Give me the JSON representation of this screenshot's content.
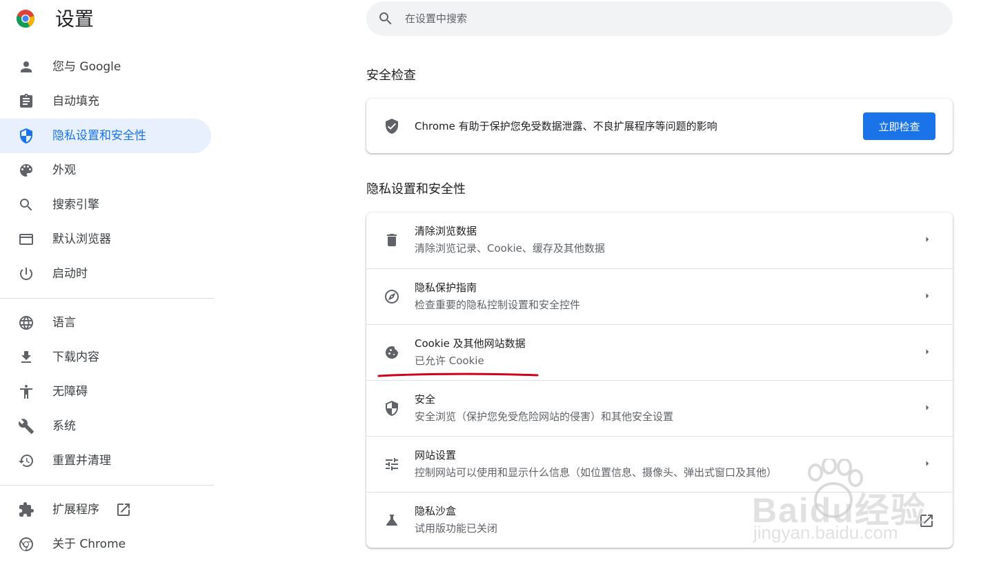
{
  "app": {
    "title": "设置"
  },
  "sidebar": {
    "items": [
      {
        "label": "您与 Google",
        "icon": "person-icon"
      },
      {
        "label": "自动填充",
        "icon": "clipboard-icon"
      },
      {
        "label": "隐私设置和安全性",
        "icon": "shield-icon",
        "active": true
      },
      {
        "label": "外观",
        "icon": "palette-icon"
      },
      {
        "label": "搜索引擎",
        "icon": "search-icon"
      },
      {
        "label": "默认浏览器",
        "icon": "browser-window-icon"
      },
      {
        "label": "启动时",
        "icon": "power-icon"
      }
    ],
    "advanced_items": [
      {
        "label": "语言",
        "icon": "globe-icon"
      },
      {
        "label": "下载内容",
        "icon": "download-icon"
      },
      {
        "label": "无障碍",
        "icon": "accessibility-icon"
      },
      {
        "label": "系统",
        "icon": "wrench-icon"
      },
      {
        "label": "重置并清理",
        "icon": "restore-icon"
      }
    ],
    "bottom_items": [
      {
        "label": "扩展程序",
        "icon": "puzzle-icon"
      },
      {
        "label": "关于 Chrome",
        "icon": "chrome-icon"
      }
    ]
  },
  "search": {
    "placeholder": "在设置中搜索"
  },
  "safety_check": {
    "section_title": "安全检查",
    "text": "Chrome 有助于保护您免受数据泄露、不良扩展程序等问题的影响",
    "button_label": "立即检查"
  },
  "privacy": {
    "section_title": "隐私设置和安全性",
    "rows": [
      {
        "title": "清除浏览数据",
        "subtitle": "清除浏览记录、Cookie、缓存及其他数据",
        "icon": "trash-icon"
      },
      {
        "title": "隐私保护指南",
        "subtitle": "检查重要的隐私控制设置和安全控件",
        "icon": "compass-icon"
      },
      {
        "title": "Cookie 及其他网站数据",
        "subtitle": "已允许 Cookie",
        "icon": "cookie-icon"
      },
      {
        "title": "安全",
        "subtitle": "安全浏览（保护您免受危险网站的侵害）和其他安全设置",
        "icon": "security-shield-icon"
      },
      {
        "title": "网站设置",
        "subtitle": "控制网站可以使用和显示什么信息（如位置信息、摄像头、弹出式窗口及其他）",
        "icon": "tune-icon"
      },
      {
        "title": "隐私沙盒",
        "subtitle": "试用版功能已关闭",
        "icon": "flask-icon"
      }
    ]
  },
  "watermark": {
    "text": "Baidu经验",
    "url": "jingyan.baidu.com"
  },
  "colors": {
    "accent": "#1a73e8",
    "active_bg": "#e8f0fe",
    "annotation": "#d0021b"
  }
}
